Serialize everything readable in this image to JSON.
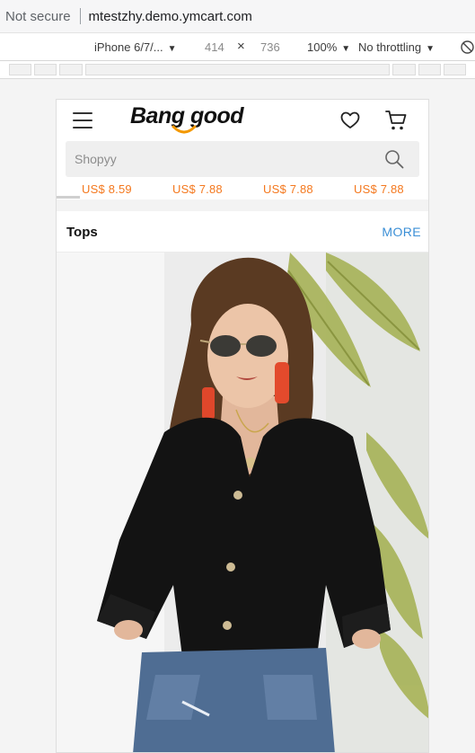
{
  "browser": {
    "security_status": "Not secure",
    "url": "mtestzhy.demo.ymcart.com"
  },
  "devtools": {
    "device": "iPhone 6/7/...",
    "width": "414",
    "times": "×",
    "height": "736",
    "zoom": "100%",
    "throttling": "No throttling"
  },
  "site": {
    "logo_text": "Bang good",
    "search_placeholder": "Shopyy",
    "prices": [
      "US$ 8.59",
      "US$ 7.88",
      "US$ 7.88",
      "US$ 7.88"
    ],
    "section": {
      "title": "Tops",
      "more_label": "MORE"
    }
  },
  "colors": {
    "price": "#f4781e",
    "more_link": "#3b8fd6",
    "logo_accent": "#f39800"
  },
  "icons": [
    "menu-icon",
    "heart-icon",
    "cart-icon",
    "search-icon",
    "rotate-icon",
    "caret-down-icon"
  ]
}
